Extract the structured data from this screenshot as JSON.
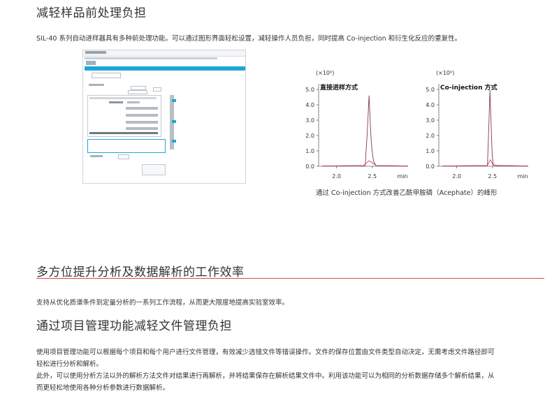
{
  "section1": {
    "title": "减轻样品前处理负担",
    "description": "SIL-40 系列自动进样器具有多种前处理功能。可以通过图形界面轻松设置，减轻操作人员负担，同时提高 Co-injection 和衍生化反应的重复性。",
    "figure_caption": "通过 Co-injection 方式改善乙酰甲胺磷（Acephate）的峰形"
  },
  "chart_data": [
    {
      "type": "line",
      "title": "直接进样方式",
      "y_multiplier": "(×10⁶)",
      "xlabel": "min",
      "x_ticks": [
        "2.0",
        "2.5"
      ],
      "y_ticks": [
        "5.0",
        "4.0",
        "3.0",
        "2.0",
        "1.0",
        "0.0"
      ],
      "xlim": [
        1.75,
        3.0
      ],
      "ylim": [
        0,
        5.0
      ],
      "series": [
        {
          "color": "#7e3a58",
          "x": [
            1.8,
            2.4,
            2.43,
            2.455,
            2.47,
            2.485,
            2.5,
            2.52,
            2.55,
            3.0
          ],
          "y": [
            0.02,
            0.05,
            2.2,
            4.6,
            3.0,
            1.6,
            0.9,
            0.3,
            0.05,
            0.02
          ]
        },
        {
          "color": "#d23a7a",
          "x": [
            1.8,
            2.38,
            2.42,
            2.45,
            2.48,
            2.52,
            2.56,
            3.0
          ],
          "y": [
            0.02,
            0.04,
            0.22,
            0.35,
            0.3,
            0.15,
            0.04,
            0.02
          ]
        }
      ]
    },
    {
      "type": "line",
      "title": "Co-injection 方式",
      "y_multiplier": "(×10⁶)",
      "xlabel": "min",
      "x_ticks": [
        "2.0",
        "2.5"
      ],
      "y_ticks": [
        "5.0",
        "4.0",
        "3.0",
        "2.0",
        "1.0",
        "0.0"
      ],
      "xlim": [
        1.75,
        3.0
      ],
      "ylim": [
        0,
        5.0
      ],
      "series": [
        {
          "color": "#7e3a58",
          "x": [
            1.8,
            2.43,
            2.45,
            2.465,
            2.48,
            2.495,
            2.51,
            2.53,
            3.0
          ],
          "y": [
            0.02,
            0.05,
            2.8,
            4.95,
            2.8,
            0.8,
            0.15,
            0.04,
            0.02
          ]
        },
        {
          "color": "#d23a7a",
          "x": [
            1.8,
            2.43,
            2.455,
            2.47,
            2.485,
            2.51,
            3.0
          ],
          "y": [
            0.02,
            0.05,
            0.3,
            0.42,
            0.3,
            0.06,
            0.02
          ]
        }
      ]
    }
  ],
  "section2": {
    "title": "多方位提升分析及数据解析的工作效率",
    "description": "支持从优化质谱条件到定量分析的一系列工作流程，从而更大限度地提高实验室效率。"
  },
  "section3": {
    "title": "通过项目管理功能减轻文件管理负担",
    "paragraph_lines": [
      "使用项目管理功能可以根据每个项目和每个用户进行文件管理，有效减少选错文件等错误操作。文件的保存位置由文件类型自动决定，无需考虑文件路径即可",
      "轻松进行分析和解析。",
      "此外，可以使用分析方法以外的解析方法文件对结果进行再解析，并将结果保存在解析结果文件中。利用该功能可以为相同的分析数据存储多个解析结果，从",
      "而更轻松地使用各种分析参数进行数据解析。"
    ]
  },
  "software_screenshot": {
    "window_title": "Method Editor"
  },
  "colors": {
    "accent_red": "#e4464b",
    "software_blue": "#1fa6d6",
    "peak_dark": "#7e3a58",
    "peak_pink": "#d23a7a"
  }
}
